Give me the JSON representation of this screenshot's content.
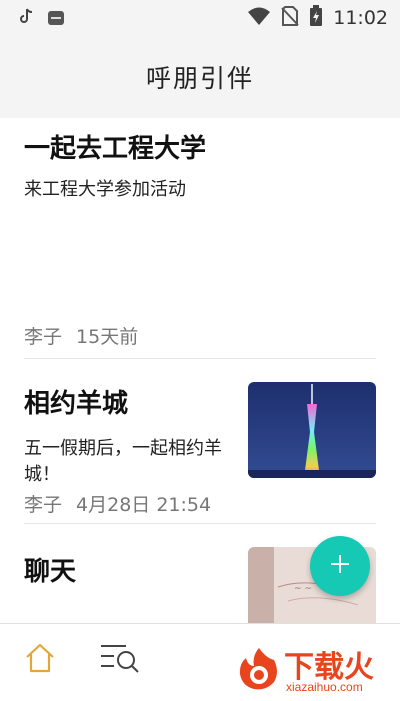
{
  "status_bar": {
    "time": "11:02",
    "icons": [
      "tiktok-icon",
      "app-icon",
      "wifi-icon",
      "no-sim-icon",
      "battery-charging-icon"
    ]
  },
  "header": {
    "title": "呼朋引伴"
  },
  "posts": [
    {
      "title": "一起去工程大学",
      "body": "来工程大学参加活动",
      "author": "李子",
      "time": "15天前"
    },
    {
      "title": "相约羊城",
      "body": "五一假期后，一起相约羊城！",
      "author": "李子",
      "time": "4月28日 21:54",
      "image": "canton-tower-night"
    },
    {
      "title": "聊天",
      "image": "handwritten-note-photo"
    }
  ],
  "fab": {
    "icon": "plus-icon",
    "color": "#16c9b4"
  },
  "bottom_nav": {
    "items": [
      {
        "icon": "home-icon",
        "active": true,
        "color": "#e2a73a"
      },
      {
        "icon": "search-list-icon",
        "active": false
      }
    ]
  },
  "watermark": {
    "text": "下载火",
    "sub": "xiazaihuo.com"
  },
  "colors": {
    "accent": "#16c9b4",
    "active_nav": "#e2a73a",
    "watermark": "#e8451e"
  }
}
